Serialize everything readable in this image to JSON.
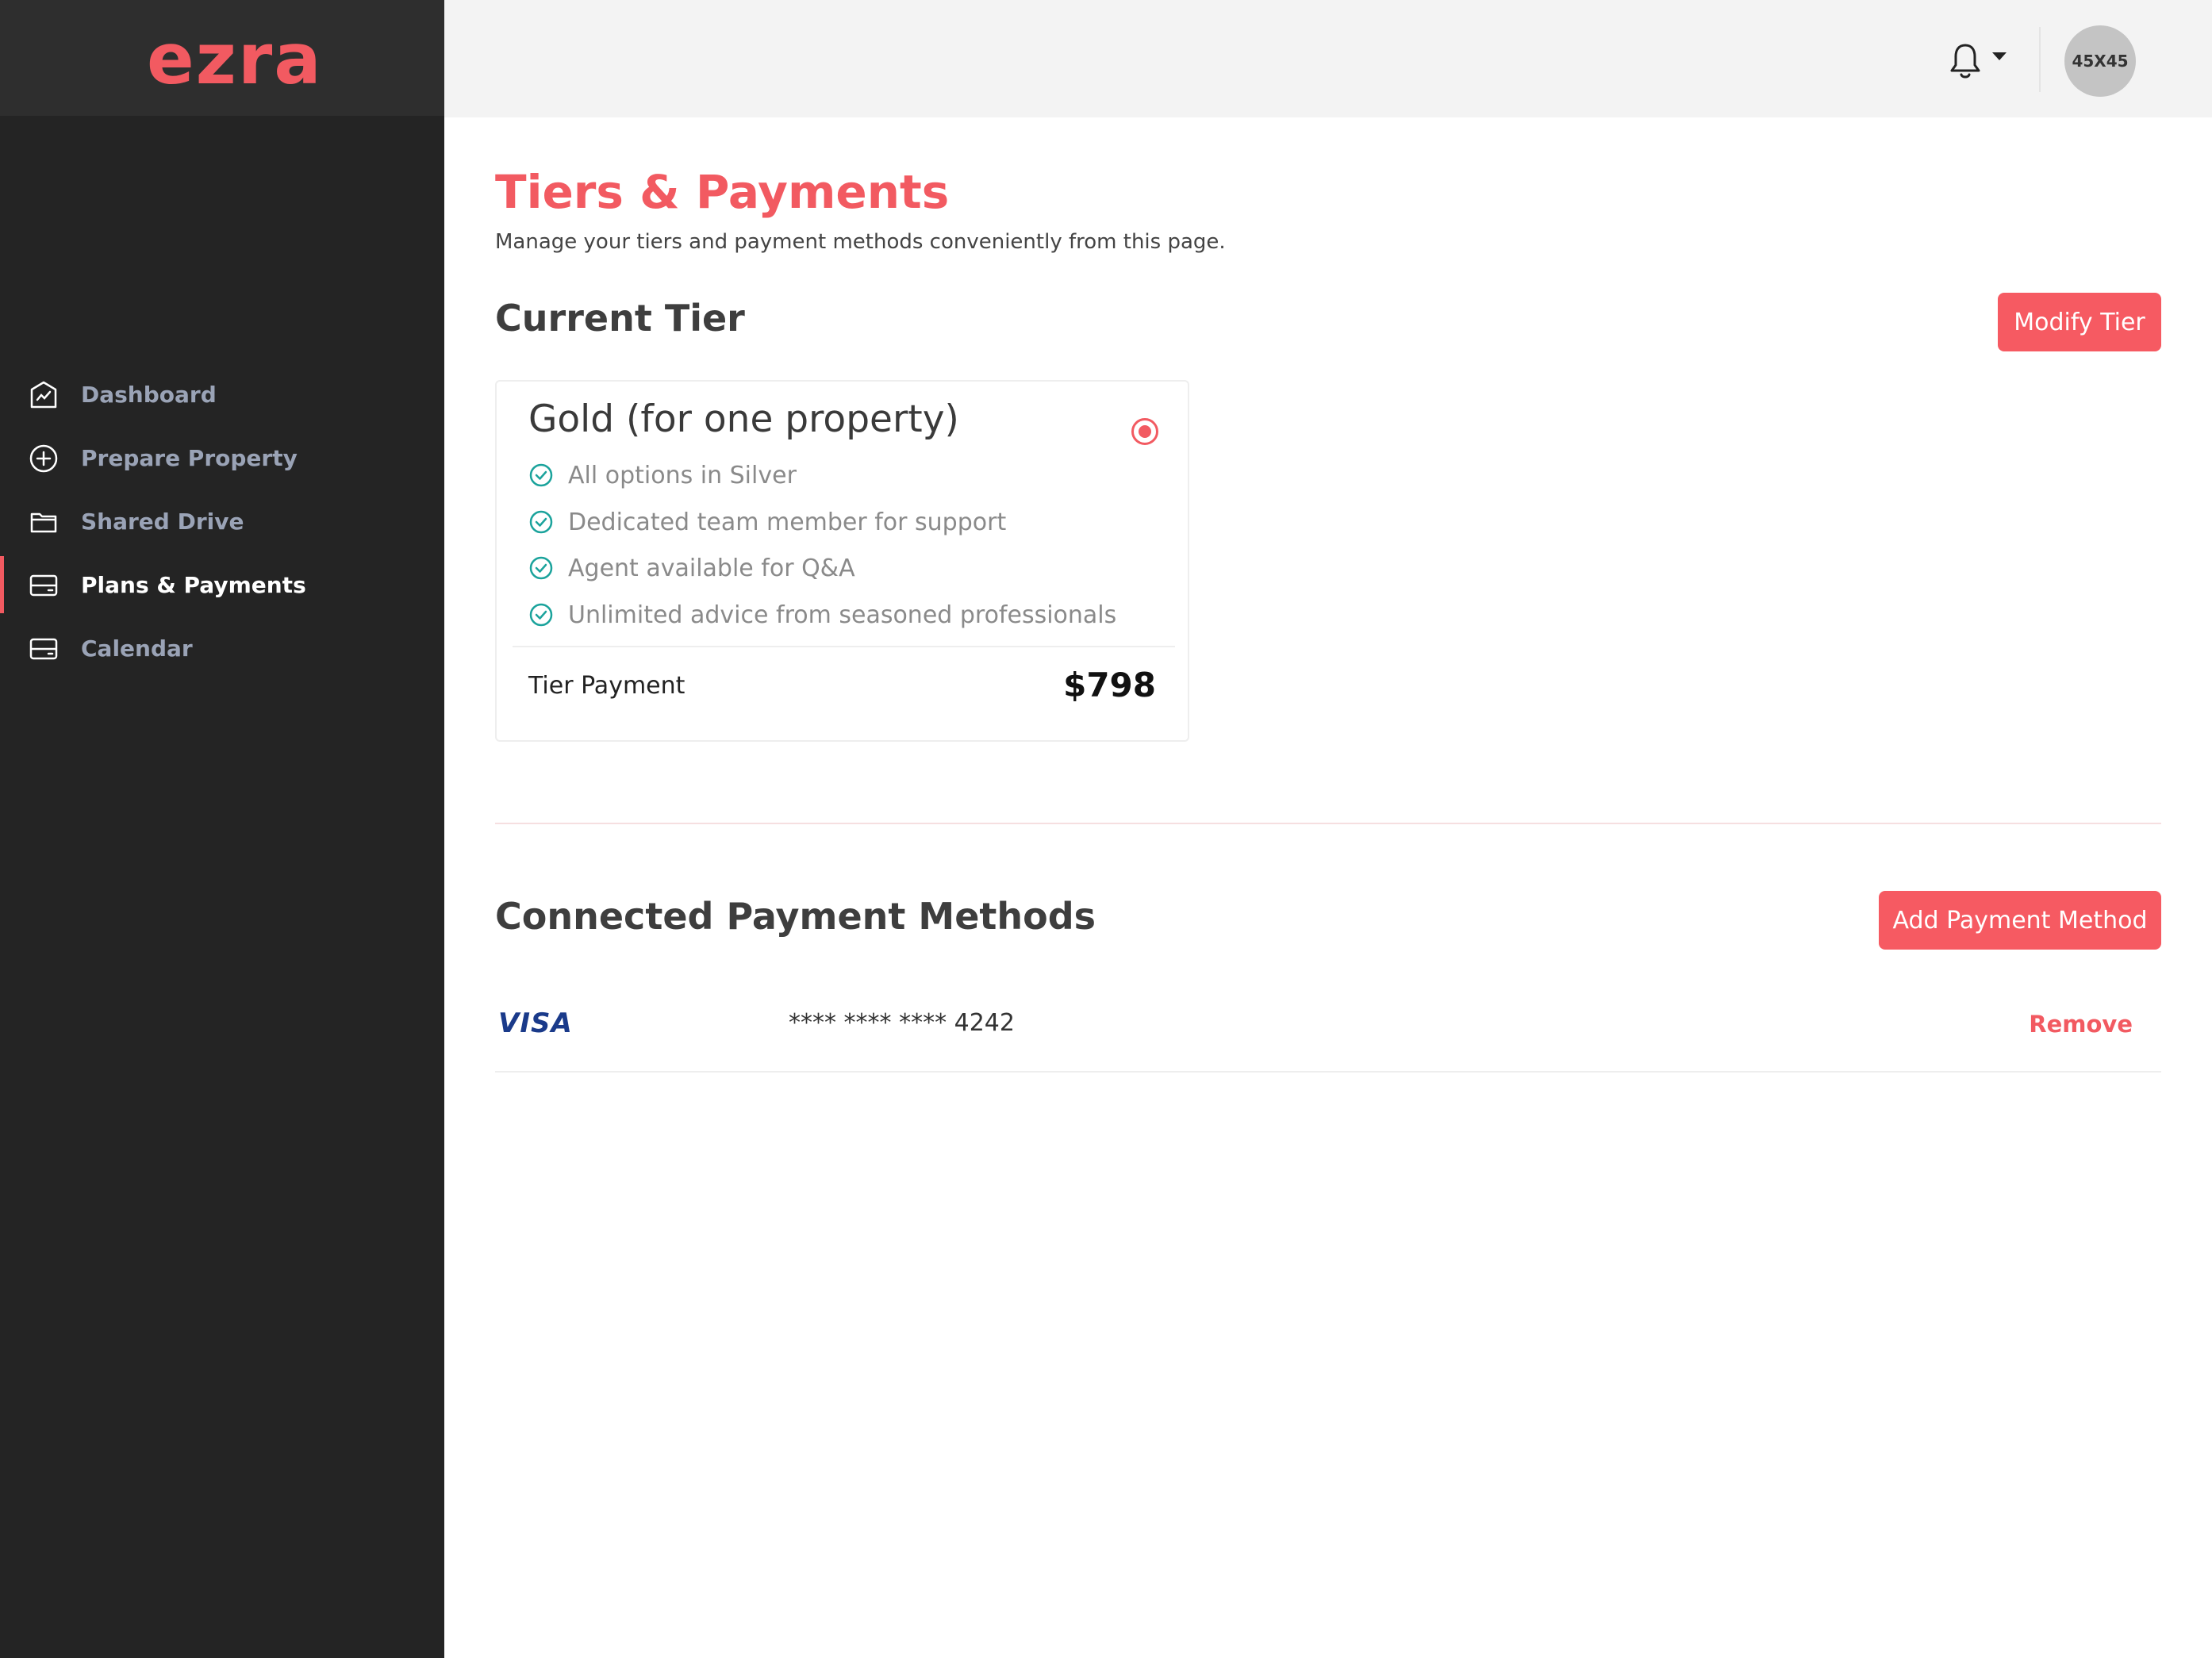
{
  "brand": {
    "logo": "ezra",
    "accent": "#f25a61"
  },
  "sidebar": {
    "items": [
      {
        "label": "Dashboard",
        "icon": "dashboard-icon"
      },
      {
        "label": "Prepare Property",
        "icon": "plus-circle-icon"
      },
      {
        "label": "Shared Drive",
        "icon": "folder-icon"
      },
      {
        "label": "Plans & Payments",
        "icon": "card-icon",
        "active": true
      },
      {
        "label": "Calendar",
        "icon": "card-icon"
      }
    ]
  },
  "header": {
    "avatar_text": "45X45"
  },
  "page": {
    "title": "Tiers & Payments",
    "subtitle": "Manage your tiers and payment methods conveniently from this page."
  },
  "current_tier": {
    "heading": "Current Tier",
    "modify_label": "Modify Tier",
    "name": "Gold (for one property)",
    "features": [
      "All options in Silver",
      "Dedicated team member for support",
      "Agent available for Q&A",
      "Unlimited advice from seasoned professionals"
    ],
    "payment_label": "Tier Payment",
    "payment_amount": "$798"
  },
  "payment_methods": {
    "heading": "Connected Payment Methods",
    "add_label": "Add Payment Method",
    "items": [
      {
        "brand": "VISA",
        "number": "**** **** **** 4242",
        "remove_label": "Remove"
      }
    ]
  }
}
